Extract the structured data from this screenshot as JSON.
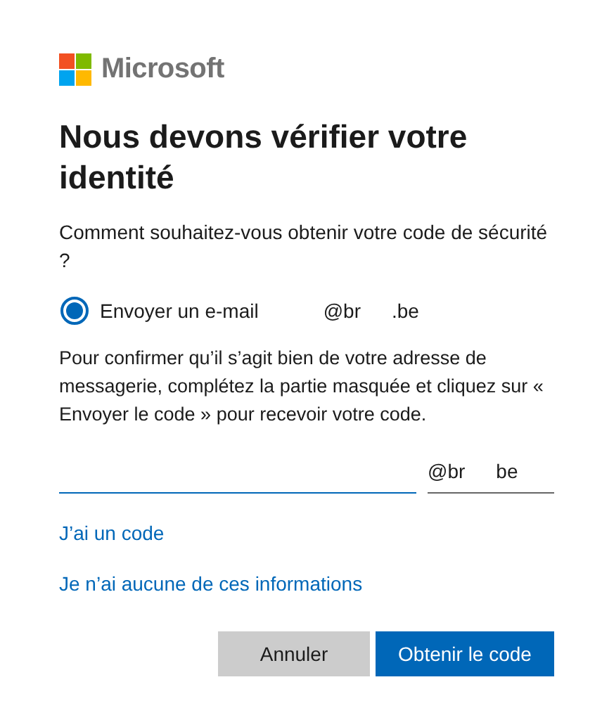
{
  "brand": "Microsoft",
  "title": "Nous devons vérifier votre identité",
  "question": "Comment souhaitez-vous obtenir votre code de sécurité ?",
  "options": [
    {
      "label": "Envoyer un e-mail",
      "email_parts": [
        "@br",
        ".be"
      ],
      "selected": true
    }
  ],
  "instructions": "Pour confirmer qu’il s’agit bien de votre adresse de messagerie, complétez la partie masquée et cliquez sur « Envoyer le code » pour recevoir votre code.",
  "email_suffix_parts": [
    "@br",
    "be"
  ],
  "links": [
    "J’ai un code",
    "Je n’ai aucune de ces informations"
  ],
  "buttons": [
    {
      "label": "Annuler",
      "kind": "secondary"
    },
    {
      "label": "Obtenir le code",
      "kind": "primary"
    }
  ]
}
